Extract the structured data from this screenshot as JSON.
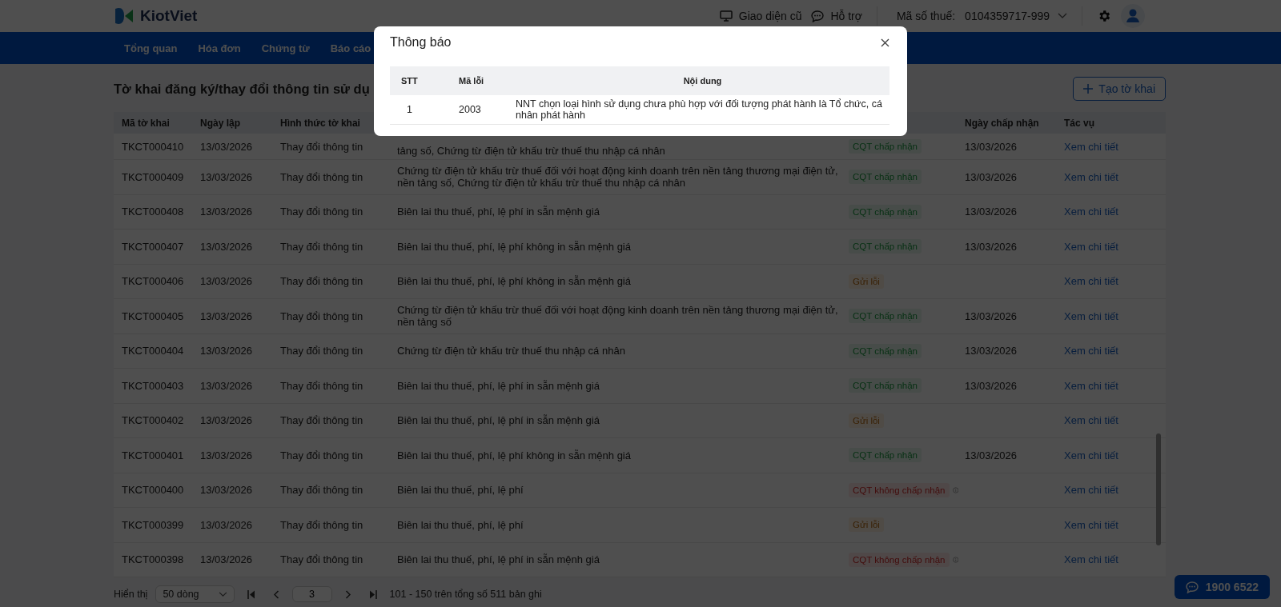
{
  "header": {
    "brand": "KiotViet",
    "old_ui": "Giao diện cũ",
    "support": "Hỗ trợ",
    "tax_label": "Mã số thuế:",
    "tax_code": "0104359717-999"
  },
  "nav": [
    {
      "label": "Tổng quan"
    },
    {
      "label": "Hóa đơn"
    },
    {
      "label": "Chứng từ"
    },
    {
      "label": "Báo cáo"
    }
  ],
  "page_title": "Tờ khai đăng ký/thay đổi thông tin sử dụ",
  "create_button": "Tạo tờ khai",
  "table": {
    "columns": [
      "Mã tờ khai",
      "Ngày lập",
      "Hình thức tờ khai",
      "Ngày chấp nhận",
      "Tác vụ"
    ],
    "rows": [
      {
        "code": "TKCT000410",
        "date": "13/03/2026",
        "type": "Thay đổi thông tin",
        "content": "tảng số, Chứng từ điện tử khấu trừ thuế thu nhập cá nhân",
        "status": {
          "kind": "accepted",
          "label": "CQT chấp nhận"
        },
        "accepted_date": "13/03/2026",
        "action": "Xem chi tiết"
      },
      {
        "code": "TKCT000409",
        "date": "13/03/2026",
        "type": "Thay đổi thông tin",
        "content": "Chứng từ điện tử khấu trừ thuế đối với hoạt động kinh doanh trên nền tảng thương mại điện tử, nền tảng số, Chứng từ điện tử khấu trừ thuế thu nhập cá nhân",
        "status": {
          "kind": "accepted",
          "label": "CQT chấp nhận"
        },
        "accepted_date": "13/03/2026",
        "action": "Xem chi tiết"
      },
      {
        "code": "TKCT000408",
        "date": "13/03/2026",
        "type": "Thay đổi thông tin",
        "content": "Biên lai thu thuế, phí, lệ phí in sẵn mệnh giá",
        "status": {
          "kind": "accepted",
          "label": "CQT chấp nhận"
        },
        "accepted_date": "13/03/2026",
        "action": "Xem chi tiết"
      },
      {
        "code": "TKCT000407",
        "date": "13/03/2026",
        "type": "Thay đổi thông tin",
        "content": "Biên lai thu thuế, phí, lệ phí không in sẵn mệnh giá",
        "status": {
          "kind": "accepted",
          "label": "CQT chấp nhận"
        },
        "accepted_date": "13/03/2026",
        "action": "Xem chi tiết"
      },
      {
        "code": "TKCT000406",
        "date": "13/03/2026",
        "type": "Thay đổi thông tin",
        "content": "Biên lai thu thuế, phí, lệ phí không in sẵn mệnh giá",
        "status": {
          "kind": "error",
          "label": "Gửi lỗi"
        },
        "action": "Xem chi tiết"
      },
      {
        "code": "TKCT000405",
        "date": "13/03/2026",
        "type": "Thay đổi thông tin",
        "content": "Chứng từ điện tử khấu trừ thuế đối với hoạt động kinh doanh trên nền tảng thương mại điện tử, nền tảng số",
        "status": {
          "kind": "accepted",
          "label": "CQT chấp nhận"
        },
        "accepted_date": "13/03/2026",
        "action": "Xem chi tiết"
      },
      {
        "code": "TKCT000404",
        "date": "13/03/2026",
        "type": "Thay đổi thông tin",
        "content": "Chứng từ điện tử khấu trừ thuế thu nhập cá nhân",
        "status": {
          "kind": "accepted",
          "label": "CQT chấp nhận"
        },
        "accepted_date": "13/03/2026",
        "action": "Xem chi tiết"
      },
      {
        "code": "TKCT000403",
        "date": "13/03/2026",
        "type": "Thay đổi thông tin",
        "content": "Biên lai thu thuế, phí, lệ phí in sẵn mệnh giá",
        "status": {
          "kind": "accepted",
          "label": "CQT chấp nhận"
        },
        "accepted_date": "13/03/2026",
        "action": "Xem chi tiết"
      },
      {
        "code": "TKCT000402",
        "date": "13/03/2026",
        "type": "Thay đổi thông tin",
        "content": "Biên lai thu thuế, phí, lệ phí in sẵn mệnh giá",
        "status": {
          "kind": "error",
          "label": "Gửi lỗi"
        },
        "action": "Xem chi tiết"
      },
      {
        "code": "TKCT000401",
        "date": "13/03/2026",
        "type": "Thay đổi thông tin",
        "content": "Biên lai thu thuế, phí, lệ phí không in sẵn mệnh giá",
        "status": {
          "kind": "accepted",
          "label": "CQT chấp nhận"
        },
        "accepted_date": "13/03/2026",
        "action": "Xem chi tiết"
      },
      {
        "code": "TKCT000400",
        "date": "13/03/2026",
        "type": "Thay đổi thông tin",
        "content": "Biên lai thu thuế, phí, lệ phí",
        "status": {
          "kind": "rejected",
          "label": "CQT không chấp nhận"
        },
        "action": "Xem chi tiết"
      },
      {
        "code": "TKCT000399",
        "date": "13/03/2026",
        "type": "Thay đổi thông tin",
        "content": "Biên lai thu thuế, phí, lệ phí",
        "status": {
          "kind": "error",
          "label": "Gửi lỗi"
        },
        "action": "Xem chi tiết"
      },
      {
        "code": "TKCT000398",
        "date": "13/03/2026",
        "type": "Thay đổi thông tin",
        "content": "Biên lai thu thuế, phí, lệ phí in sẵn mệnh giá",
        "status": {
          "kind": "rejected",
          "label": "CQT không chấp nhận"
        },
        "action": "Xem chi tiết"
      }
    ]
  },
  "pagination": {
    "show_label": "Hiển thị",
    "page_size": "50 dòng",
    "page": "3",
    "summary": "101 - 150 trên tổng số 511 bản ghi"
  },
  "hotline": "1900 6522",
  "modal": {
    "title": "Thông báo",
    "columns": [
      "STT",
      "Mã lỗi",
      "Nội dung"
    ],
    "rows": [
      {
        "index": "1",
        "code": "2003",
        "message": "NNT chọn loại hình sử dụng chưa phù hợp với đối tượng phát hành là Tổ chức, cá nhân phát hành"
      }
    ]
  }
}
